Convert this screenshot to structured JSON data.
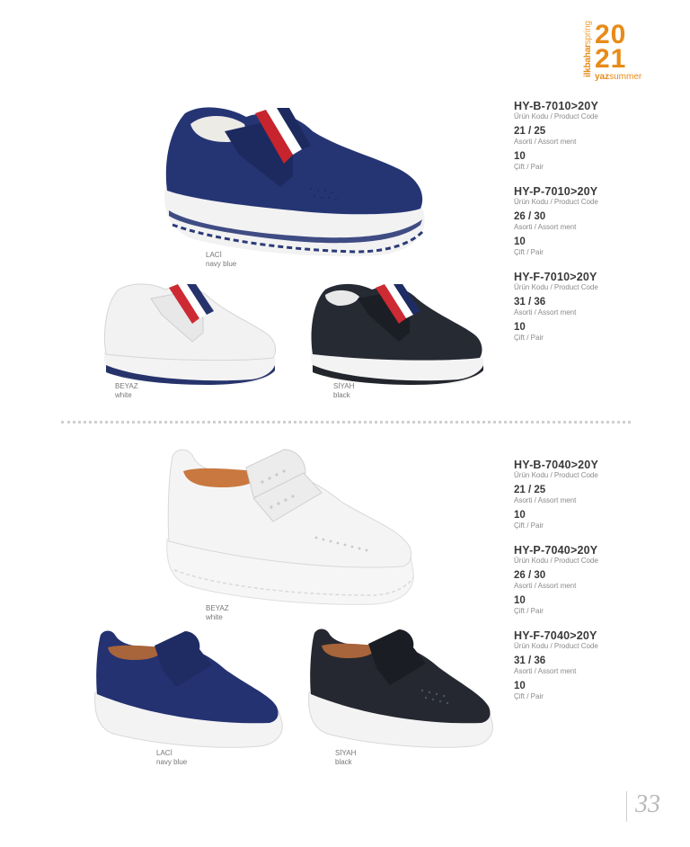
{
  "badge": {
    "side_bold": "ilkbahar",
    "side_light": "spring",
    "year_top": "20",
    "year_bottom": "21",
    "bottom_bold": "yaz",
    "bottom_light": "summer"
  },
  "labels": {
    "product_code": "Ürün Kodu / Product Code",
    "assortment": "Asorti / Assort ment",
    "pair": "Çift / Pair"
  },
  "section1": {
    "products": [
      {
        "code": "HY-B-7010>20Y",
        "size": "21 / 25",
        "qty": "10"
      },
      {
        "code": "HY-P-7010>20Y",
        "size": "26 / 30",
        "qty": "10"
      },
      {
        "code": "HY-F-7010>20Y",
        "size": "31 / 36",
        "qty": "10"
      }
    ],
    "captions": [
      {
        "tr": "LACİ",
        "en": "navy blue"
      },
      {
        "tr": "BEYAZ",
        "en": "white"
      },
      {
        "tr": "SİYAH",
        "en": "black"
      }
    ]
  },
  "section2": {
    "products": [
      {
        "code": "HY-B-7040>20Y",
        "size": "21 / 25",
        "qty": "10"
      },
      {
        "code": "HY-P-7040>20Y",
        "size": "26 / 30",
        "qty": "10"
      },
      {
        "code": "HY-F-7040>20Y",
        "size": "31 / 36",
        "qty": "10"
      }
    ],
    "captions": [
      {
        "tr": "BEYAZ",
        "en": "white"
      },
      {
        "tr": "LACİ",
        "en": "navy blue"
      },
      {
        "tr": "SİYAH",
        "en": "black"
      }
    ]
  },
  "page_number": "33",
  "colors": {
    "accent": "#e88b18",
    "navy": "#27346b",
    "black": "#23262d",
    "white_leather": "#f1f1f1"
  }
}
